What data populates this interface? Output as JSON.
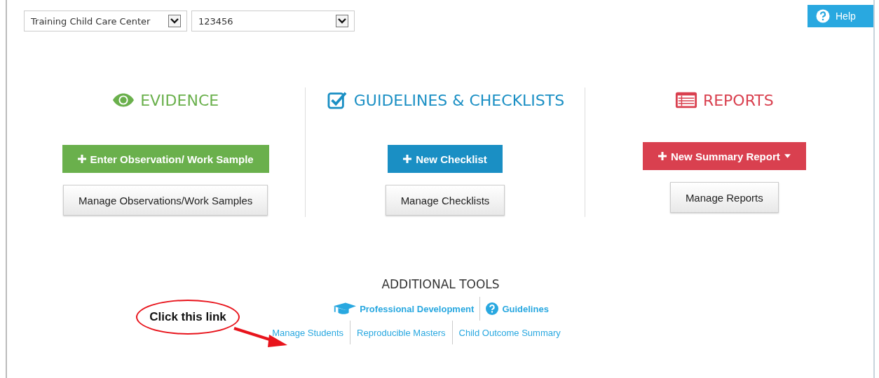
{
  "selects": [
    {
      "value": "Training Child Care Center"
    },
    {
      "value": "123456"
    }
  ],
  "help": {
    "label": "Help"
  },
  "sections": [
    {
      "title": "EVIDENCE",
      "kind": "eye",
      "color": "#6ab04c",
      "primary": {
        "label": "Enter Observation/ Work Sample",
        "dropdown": false
      },
      "secondary": "Manage Observations/Work Samples"
    },
    {
      "title": "GUIDELINES & CHECKLISTS",
      "kind": "check",
      "color": "#1a8fc4",
      "primary": {
        "label": "New Checklist",
        "dropdown": false
      },
      "secondary": "Manage Checklists"
    },
    {
      "title": "REPORTS",
      "kind": "list",
      "color": "#d9404f",
      "primary": {
        "label": "New Summary Report",
        "dropdown": true
      },
      "secondary": "Manage Reports"
    }
  ],
  "additional_tools": {
    "title": "ADDITIONAL TOOLS",
    "row_1": [
      {
        "label": "Professional Development",
        "kind": "cap"
      },
      {
        "label": "Guidelines",
        "kind": "question"
      }
    ],
    "row_2": [
      {
        "label": "Manage Students"
      },
      {
        "label": "Reproducible Masters"
      },
      {
        "label": "Child Outcome Summary"
      }
    ]
  },
  "annotation": {
    "text": "Click this link"
  }
}
